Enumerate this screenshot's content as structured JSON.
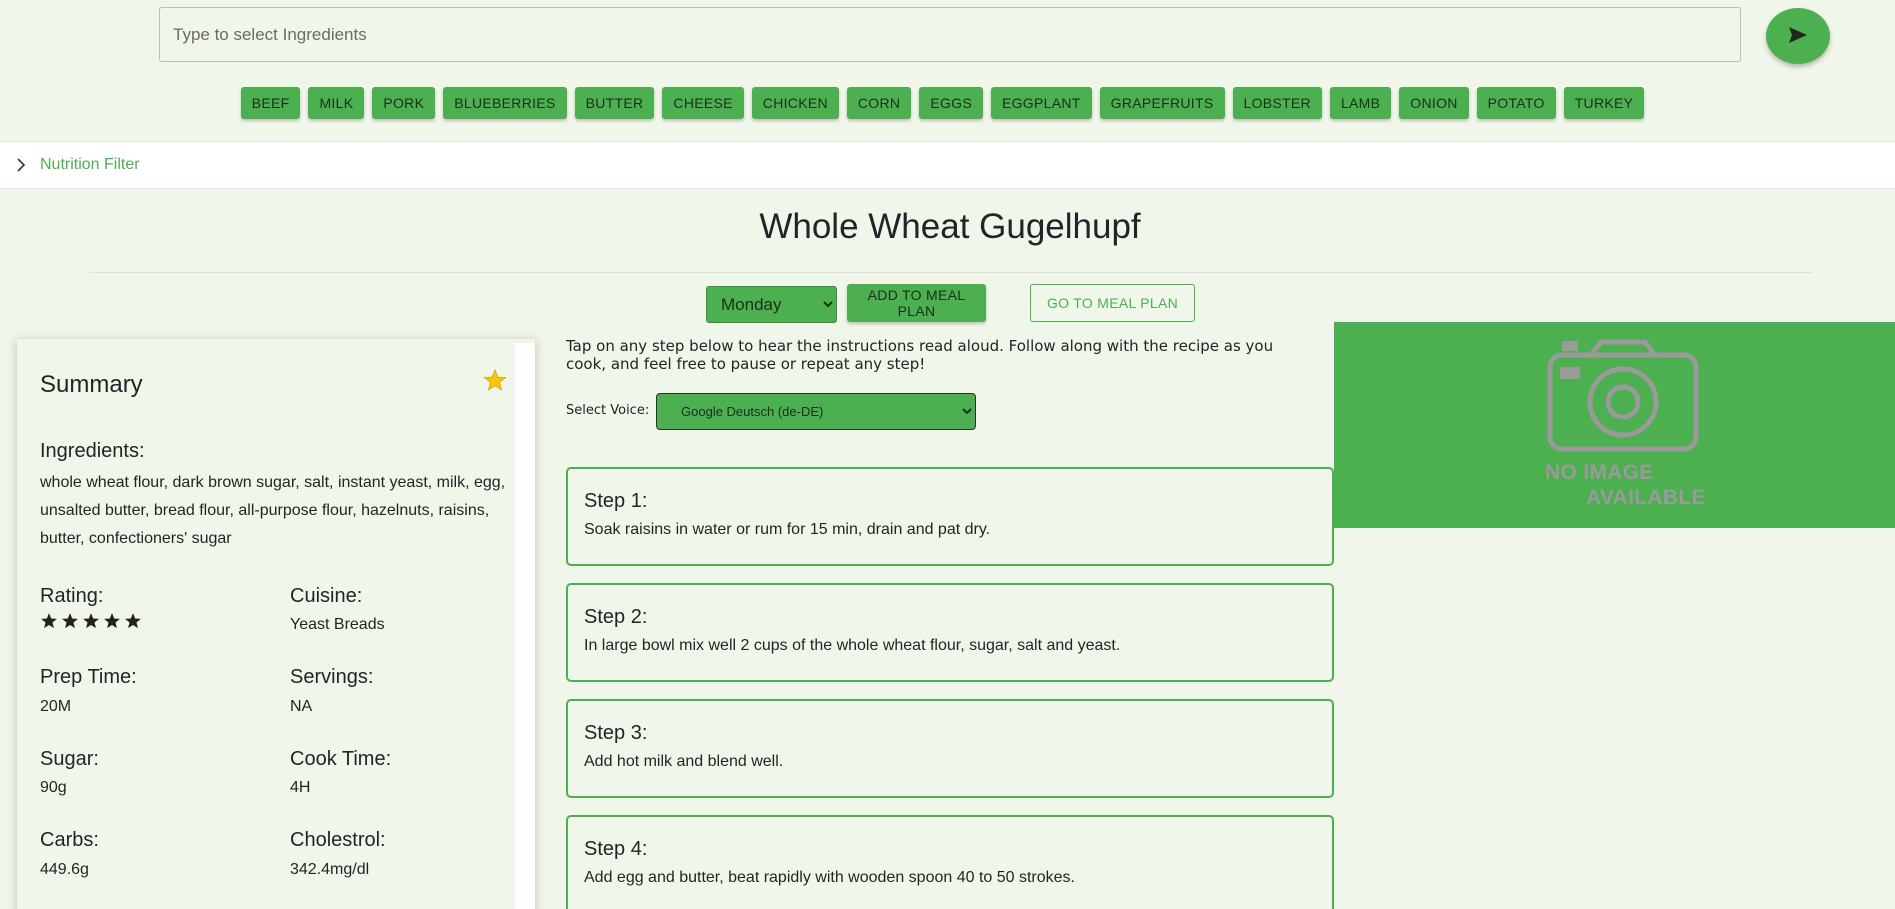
{
  "search": {
    "placeholder": "Type to select Ingredients"
  },
  "icons": {
    "send": "send-icon",
    "chevron": "chevron-right-icon",
    "star": "star-icon",
    "camera": "camera-icon"
  },
  "colors": {
    "accent": "#4caf50",
    "background": "#f1f6ea",
    "star": "#f5c518"
  },
  "ingredient_chips": [
    "BEEF",
    "MILK",
    "PORK",
    "BLUEBERRIES",
    "BUTTER",
    "CHEESE",
    "CHICKEN",
    "CORN",
    "EGGS",
    "EGGPLANT",
    "GRAPEFRUITS",
    "LOBSTER",
    "LAMB",
    "ONION",
    "POTATO",
    "TURKEY"
  ],
  "nutrition_filter": {
    "label": "Nutrition Filter"
  },
  "recipe": {
    "title": "Whole Wheat Gugelhupf"
  },
  "meal_plan": {
    "selected_day": "Monday",
    "add_label": "ADD TO MEAL PLAN",
    "go_label": "GO TO MEAL PLAN"
  },
  "summary": {
    "title": "Summary",
    "favorited": true,
    "ingredients_heading": "Ingredients:",
    "ingredients_text": "whole wheat flour, dark brown sugar, salt, instant yeast, milk, egg, unsalted butter, bread flour, all-purpose flour, hazelnuts, raisins, butter, confectioners' sugar",
    "rating_label": "Rating:",
    "rating_value": 5,
    "rating_max": 5,
    "cuisine_label": "Cuisine:",
    "cuisine_value": "Yeast Breads",
    "prep_label": "Prep Time:",
    "prep_value": "20M",
    "servings_label": "Servings:",
    "servings_value": "NA",
    "sugar_label": "Sugar:",
    "sugar_value": "90g",
    "cook_label": "Cook Time:",
    "cook_value": "4H",
    "carbs_label": "Carbs:",
    "carbs_value": "449.6g",
    "cholestrol_label": "Cholestrol:",
    "cholestrol_value": "342.4mg/dl"
  },
  "instructions": {
    "intro": "Tap on any step below to hear the instructions read aloud. Follow along with the recipe as you cook, and feel free to pause or repeat any step!",
    "voice_label": "Select Voice:",
    "voice_value": "Google Deutsch (de-DE)"
  },
  "steps": [
    {
      "title": "Step 1:",
      "text": "Soak raisins in water or rum for 15 min, drain and pat dry."
    },
    {
      "title": "Step 2:",
      "text": "In large bowl mix well 2 cups of the whole wheat flour, sugar, salt and yeast."
    },
    {
      "title": "Step 3:",
      "text": "Add hot milk and blend well."
    },
    {
      "title": "Step 4:",
      "text": "Add egg and butter, beat rapidly with wooden spoon 40 to 50 strokes."
    }
  ],
  "image_placeholder": {
    "line1": "NO IMAGE",
    "line2": "AVAILABLE"
  }
}
